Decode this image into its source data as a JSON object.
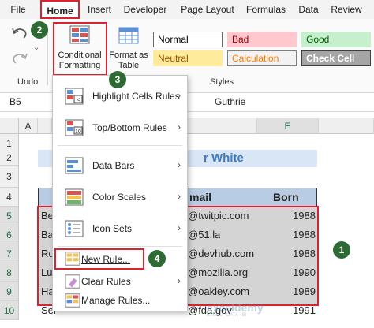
{
  "menubar": {
    "tabs": [
      "File",
      "Home",
      "Insert",
      "Developer",
      "Page Layout",
      "Formulas",
      "Data",
      "Review"
    ],
    "active_tab": "Home"
  },
  "ribbon": {
    "undo_group_label": "Undo",
    "conditional_formatting": "Conditional\nFormatting",
    "format_as_table": "Format as\nTable",
    "styles_group_label": "Styles",
    "styles": [
      {
        "name": "Normal",
        "bg": "#ffffff",
        "fg": "#000000",
        "border": "#6a6a6a"
      },
      {
        "name": "Bad",
        "bg": "#ffc7ce",
        "fg": "#9c0006",
        "border": "#ffc7ce"
      },
      {
        "name": "Good",
        "bg": "#c6efce",
        "fg": "#006100",
        "border": "#c6efce"
      },
      {
        "name": "Neutral",
        "bg": "#ffeb9c",
        "fg": "#9c5700",
        "border": "#ffeb9c"
      },
      {
        "name": "Calculation",
        "bg": "#f2f2f2",
        "fg": "#fa7d00",
        "border": "#7f7f7f"
      },
      {
        "name": "Check Cell",
        "bg": "#a5a5a5",
        "fg": "#ffffff",
        "border": "#3f3f3f"
      }
    ]
  },
  "formula_bar": {
    "name_box": "B5",
    "content": "Guthrie"
  },
  "badges": {
    "b1": "1",
    "b2": "2",
    "b3": "3",
    "b4": "4"
  },
  "grid": {
    "columns": [
      "A",
      "E"
    ],
    "rows": [
      "1",
      "2",
      "3",
      "4",
      "5",
      "6",
      "7",
      "8",
      "9",
      "10"
    ],
    "title_text": "r White",
    "headers": {
      "email": "mail",
      "born": "Born"
    },
    "name_fragments": [
      "Be",
      "Ba",
      "Ro",
      "Lu",
      "Ha",
      "Sel"
    ],
    "emails": [
      "@twitpic.com",
      "@51.la",
      "@devhub.com",
      "@mozilla.org",
      "@oakley.com",
      "@fda.gov"
    ],
    "born": [
      "1988",
      "1988",
      "1988",
      "1990",
      "1989",
      "1991"
    ]
  },
  "cf_menu": {
    "items": [
      {
        "label": "Highlight Cells Rules",
        "submenu": true
      },
      {
        "label": "Top/Bottom Rules",
        "submenu": true
      },
      {
        "label": "Data Bars",
        "submenu": true
      },
      {
        "label": "Color Scales",
        "submenu": true
      },
      {
        "label": "Icon Sets",
        "submenu": true
      },
      {
        "label": "New Rule...",
        "submenu": false
      },
      {
        "label": "Clear Rules",
        "submenu": true
      },
      {
        "label": "Manage Rules...",
        "submenu": false
      }
    ]
  },
  "watermark": {
    "name": "exceldemy",
    "tagline": "EXCEL · DATA · BI"
  }
}
